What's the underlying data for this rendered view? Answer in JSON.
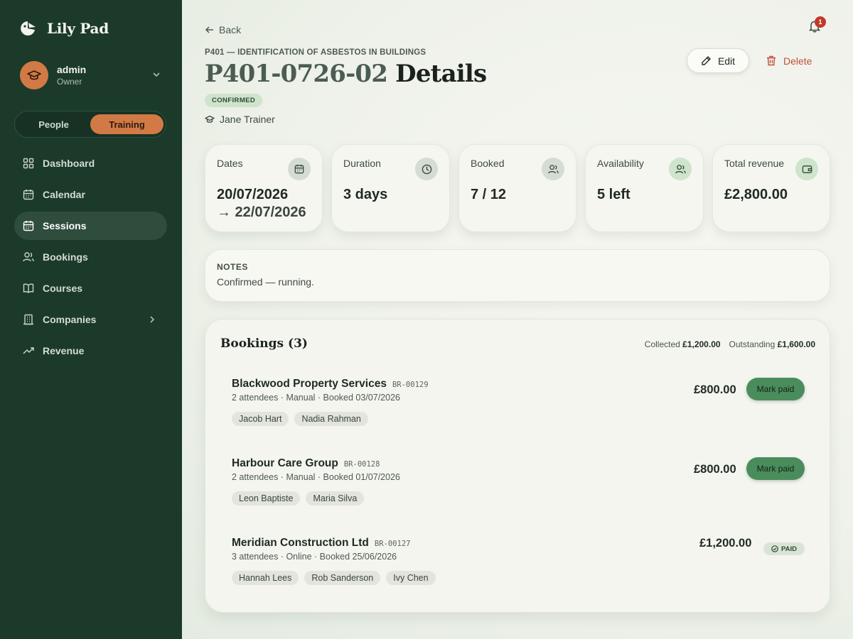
{
  "app": {
    "name": "Lily Pad"
  },
  "user": {
    "name": "admin",
    "role": "Owner"
  },
  "mode_switch": {
    "options": [
      "People",
      "Training"
    ],
    "selected": "Training"
  },
  "nav": {
    "items": [
      {
        "label": "Dashboard",
        "icon": "grid-icon"
      },
      {
        "label": "Calendar",
        "icon": "calendar-icon"
      },
      {
        "label": "Sessions",
        "icon": "calendar-icon",
        "active": true
      },
      {
        "label": "Bookings",
        "icon": "users-icon"
      },
      {
        "label": "Courses",
        "icon": "book-icon"
      },
      {
        "label": "Companies",
        "icon": "building-icon",
        "has_submenu": true
      },
      {
        "label": "Revenue",
        "icon": "trend-icon"
      }
    ]
  },
  "header": {
    "back_label": "Back",
    "notification_count": "1",
    "course": "P401 — IDENTIFICATION OF ASBESTOS IN BUILDINGS",
    "session_code": "P401-0726-02",
    "title_word": "Details",
    "status": "CONFIRMED",
    "trainer": "Jane Trainer",
    "edit_label": "Edit",
    "delete_label": "Delete"
  },
  "stats": [
    {
      "label": "Dates",
      "value": "20/07/2026",
      "value2": "→ 22/07/2026",
      "icon": "calendar-icon"
    },
    {
      "label": "Duration",
      "value": "3 days",
      "icon": "clock-icon"
    },
    {
      "label": "Booked",
      "value": "7 / 12",
      "icon": "users-icon"
    },
    {
      "label": "Availability",
      "value": "5 left",
      "icon": "users-icon"
    },
    {
      "label": "Total revenue",
      "value": "£2,800.00",
      "icon": "wallet-icon"
    }
  ],
  "notes": {
    "label": "NOTES",
    "text": "Confirmed — running."
  },
  "bookings": {
    "title": "Bookings (3)",
    "collected_label": "Collected",
    "collected": "£1,200.00",
    "outstanding_label": "Outstanding",
    "outstanding": "£1,600.00",
    "mark_paid_label": "Mark paid",
    "paid_label": "PAID",
    "rows": [
      {
        "company": "Blackwood Property Services",
        "ref": "BR-00129",
        "meta": "2 attendees · Manual · Booked 03/07/2026",
        "attendees": [
          "Jacob Hart",
          "Nadia Rahman"
        ],
        "amount": "£800.00",
        "paid": false
      },
      {
        "company": "Harbour Care Group",
        "ref": "BR-00128",
        "meta": "2 attendees · Manual · Booked 01/07/2026",
        "attendees": [
          "Leon Baptiste",
          "Maria Silva"
        ],
        "amount": "£800.00",
        "paid": false
      },
      {
        "company": "Meridian Construction Ltd",
        "ref": "BR-00127",
        "meta": "3 attendees · Online · Booked 25/06/2026",
        "attendees": [
          "Hannah Lees",
          "Rob Sanderson",
          "Ivy Chen"
        ],
        "amount": "£1,200.00",
        "paid": true
      }
    ]
  },
  "colors": {
    "sidebar_bg": "#1c3a2a",
    "accent_orange": "#d27a45",
    "mark_paid_green": "#4b8c5c",
    "delete_red": "#c0503a",
    "status_badge_bg": "#cfe3cd"
  }
}
